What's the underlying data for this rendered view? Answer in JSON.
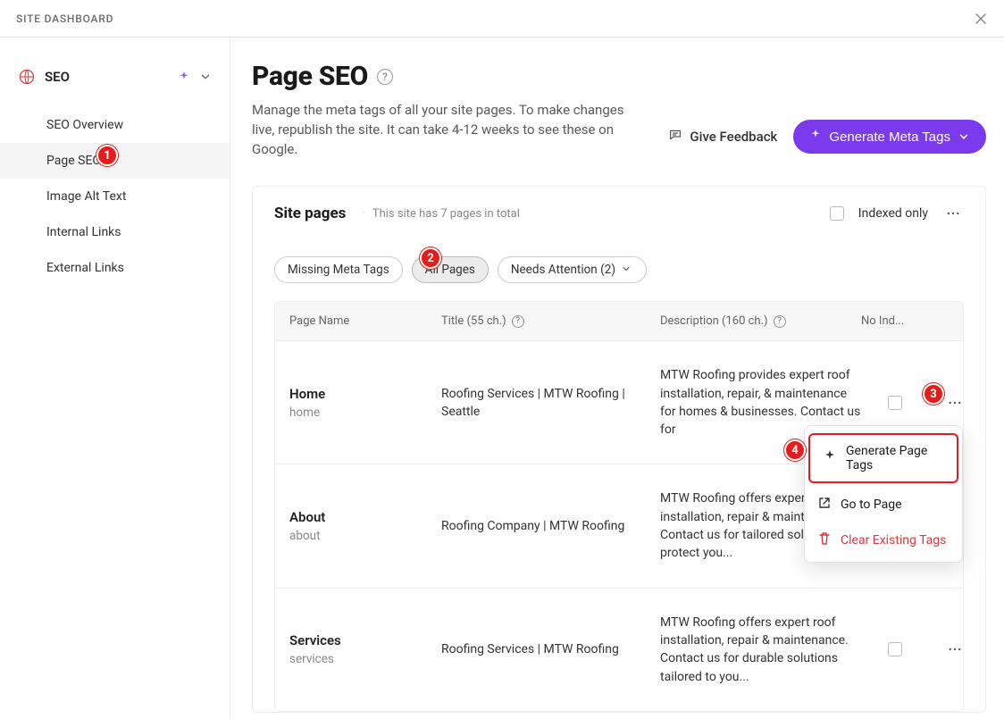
{
  "topbar": {
    "title": "SITE DASHBOARD"
  },
  "sidebar": {
    "section": "SEO",
    "items": [
      {
        "label": "SEO Overview"
      },
      {
        "label": "Page SEO"
      },
      {
        "label": "Image Alt Text"
      },
      {
        "label": "Internal Links"
      },
      {
        "label": "External Links"
      }
    ]
  },
  "page": {
    "title": "Page SEO",
    "description": "Manage the meta tags of all your site pages. To make changes live, republish the site. It can take 4-12 weeks to see these on Google."
  },
  "actions": {
    "feedback": "Give Feedback",
    "generate": "Generate Meta Tags"
  },
  "card": {
    "title": "Site pages",
    "sub": "This site has 7 pages in total",
    "indexed_only": "Indexed only"
  },
  "filters": {
    "missing": "Missing Meta Tags",
    "all": "All Pages",
    "needs": "Needs Attention (2)"
  },
  "table": {
    "headers": {
      "name": "Page Name",
      "title": "Title (55 ch.)",
      "desc": "Description (160 ch.)",
      "noindex": "No Ind..."
    },
    "rows": [
      {
        "name": "Home",
        "slug": "home",
        "title": "Roofing Services | MTW Roofing | Seattle",
        "desc": "MTW Roofing provides expert roof installation, repair, & maintenance for homes & businesses. Contact us for"
      },
      {
        "name": "About",
        "slug": "about",
        "title": "Roofing Company | MTW Roofing",
        "desc": "MTW Roofing offers expert installation, repair & maintenance. Contact us for tailored solutions to protect you..."
      },
      {
        "name": "Services",
        "slug": "services",
        "title": "Roofing Services | MTW Roofing",
        "desc": "MTW Roofing offers expert roof installation, repair & maintenance. Contact us for durable solutions tailored to you..."
      }
    ]
  },
  "menu": {
    "generate": "Generate Page Tags",
    "goto": "Go to Page",
    "clear": "Clear Existing Tags"
  },
  "annotations": {
    "a1": "1",
    "a2": "2",
    "a3": "3",
    "a4": "4"
  }
}
